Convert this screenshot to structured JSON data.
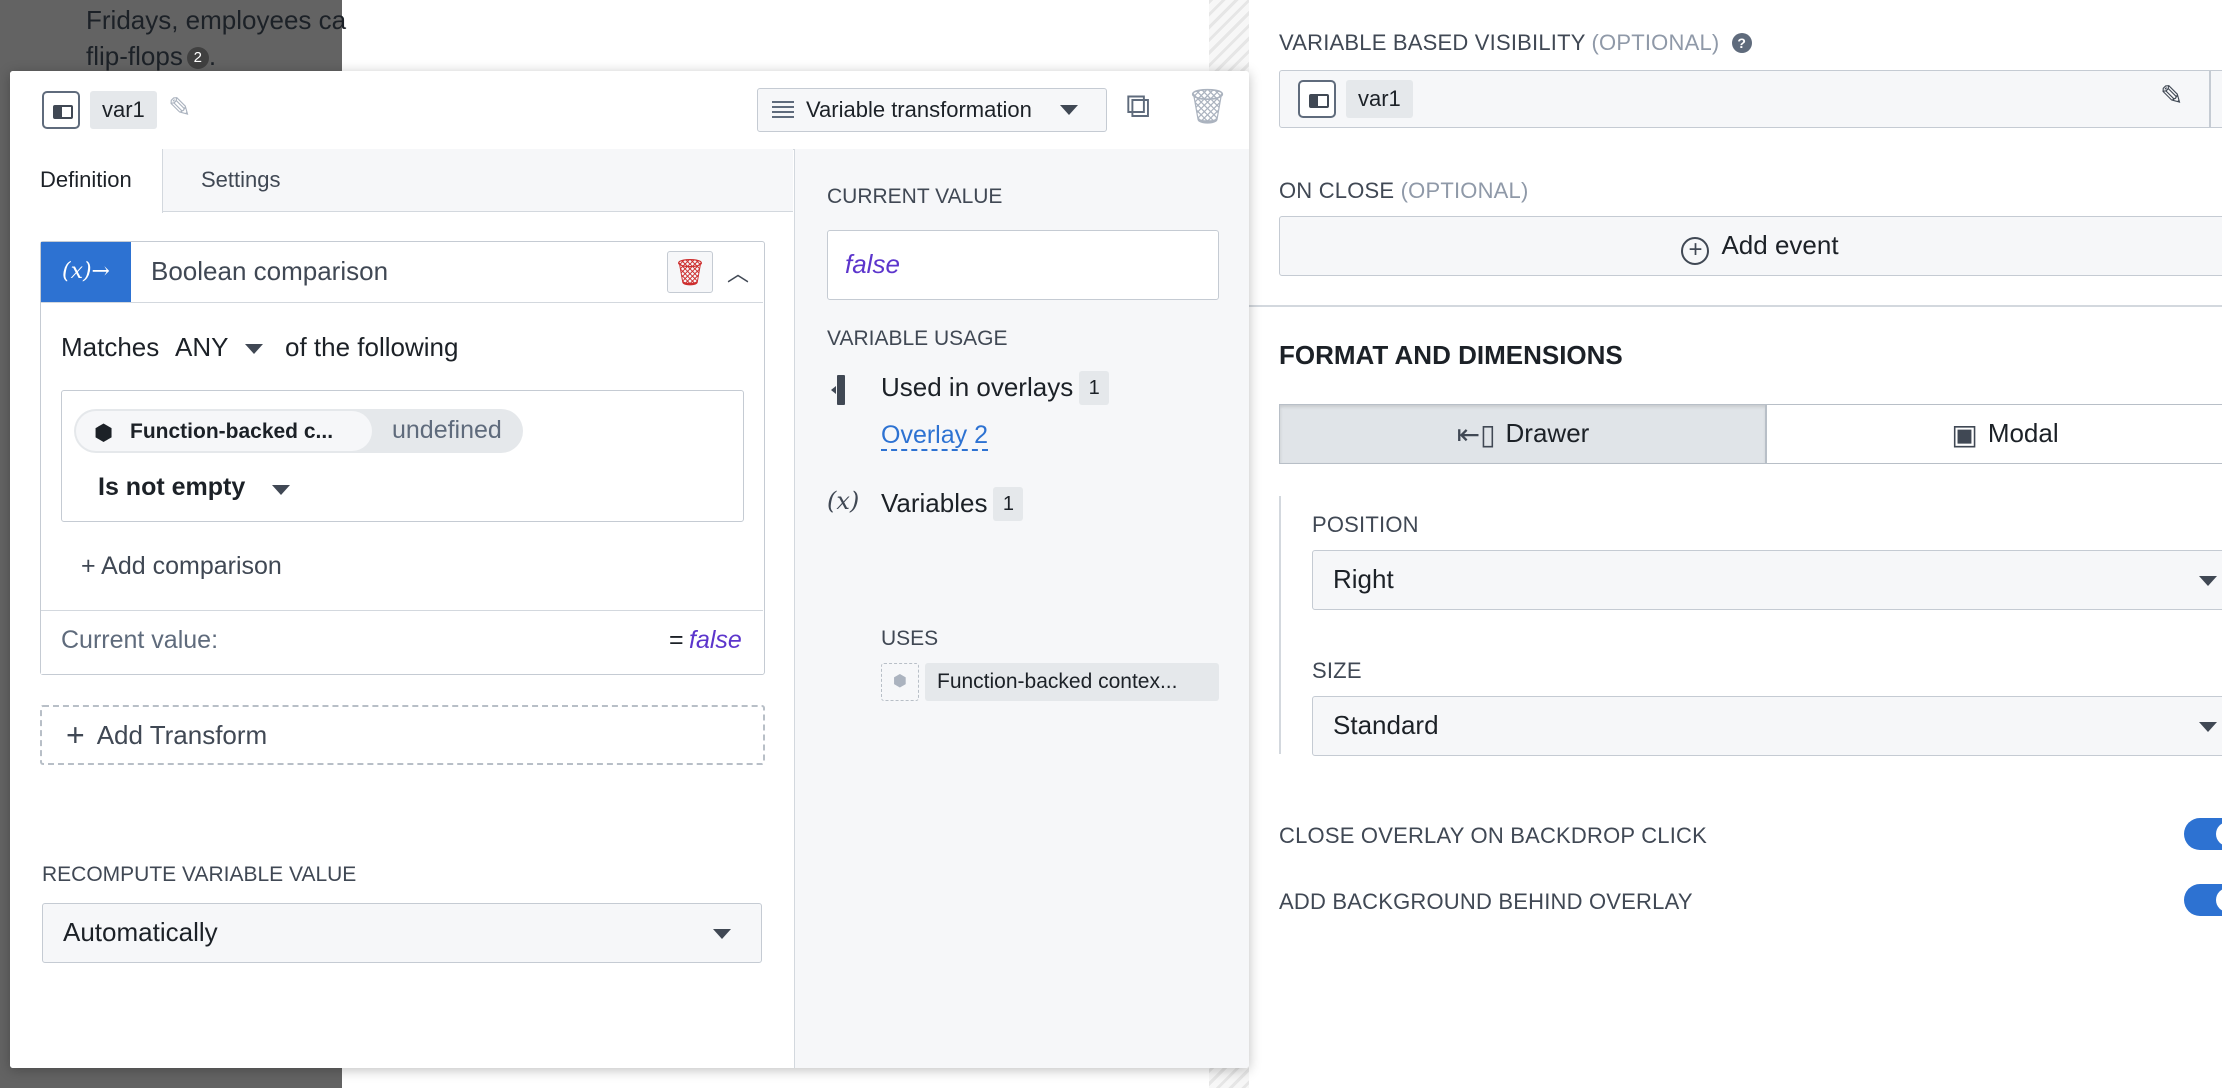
{
  "background": {
    "text_line1": "Fridays, employees ca",
    "text_line2": "flip-flops",
    "footnote": "2"
  },
  "dialog": {
    "variable_name": "var1",
    "type_select": "Variable transformation",
    "tabs": [
      {
        "label": "Definition"
      },
      {
        "label": "Settings"
      }
    ],
    "transform": {
      "badge": "(x)→",
      "title": "Boolean comparison",
      "matches_prefix": "Matches",
      "matches_value": "ANY",
      "matches_suffix": "of the following",
      "condition_source": "Function-backed c...",
      "condition_value": "undefined",
      "operator": "Is not empty",
      "add_comparison": "+ Add comparison",
      "current_value_label": "Current value:",
      "current_value_eq": "=",
      "current_value": "false"
    },
    "add_transform": "Add Transform",
    "recompute_label": "RECOMPUTE VARIABLE VALUE",
    "recompute_value": "Automatically"
  },
  "usage": {
    "current_value_label": "CURRENT VALUE",
    "current_value": "false",
    "variable_usage_label": "VARIABLE USAGE",
    "overlays_label": "Used in overlays",
    "overlays_count": "1",
    "overlay_link": "Overlay 2",
    "variables_icon": "(x)",
    "variables_label": "Variables",
    "variables_count": "1",
    "uses_label": "USES",
    "uses_item": "Function-backed contex..."
  },
  "right_panel": {
    "visibility_label": "VARIABLE BASED VISIBILITY",
    "visibility_optional": "(OPTIONAL)",
    "visibility_variable": "var1",
    "on_close_label": "ON CLOSE",
    "on_close_optional": "(OPTIONAL)",
    "add_event": "Add event",
    "format_heading": "FORMAT AND DIMENSIONS",
    "mode_drawer": "Drawer",
    "mode_modal": "Modal",
    "position_label": "POSITION",
    "position_value": "Right",
    "size_label": "SIZE",
    "size_value": "Standard",
    "close_on_backdrop_label": "CLOSE OVERLAY ON BACKDROP CLICK",
    "close_on_backdrop": true,
    "background_label": "ADD BACKGROUND BEHIND OVERLAY",
    "background_enabled": true
  },
  "colors": {
    "accent": "#2d72d2",
    "danger": "#cd2e2e",
    "value_purple": "#5c35cc"
  },
  "icons": {
    "variable": "variable-icon",
    "pencil": "pencil-icon",
    "close": "close-icon",
    "duplicate": "duplicate-icon",
    "trash": "trash-icon",
    "plus_circle": "plus-circle-icon",
    "drawer": "drawer-icon",
    "modal": "modal-icon",
    "cube": "cube-icon"
  }
}
